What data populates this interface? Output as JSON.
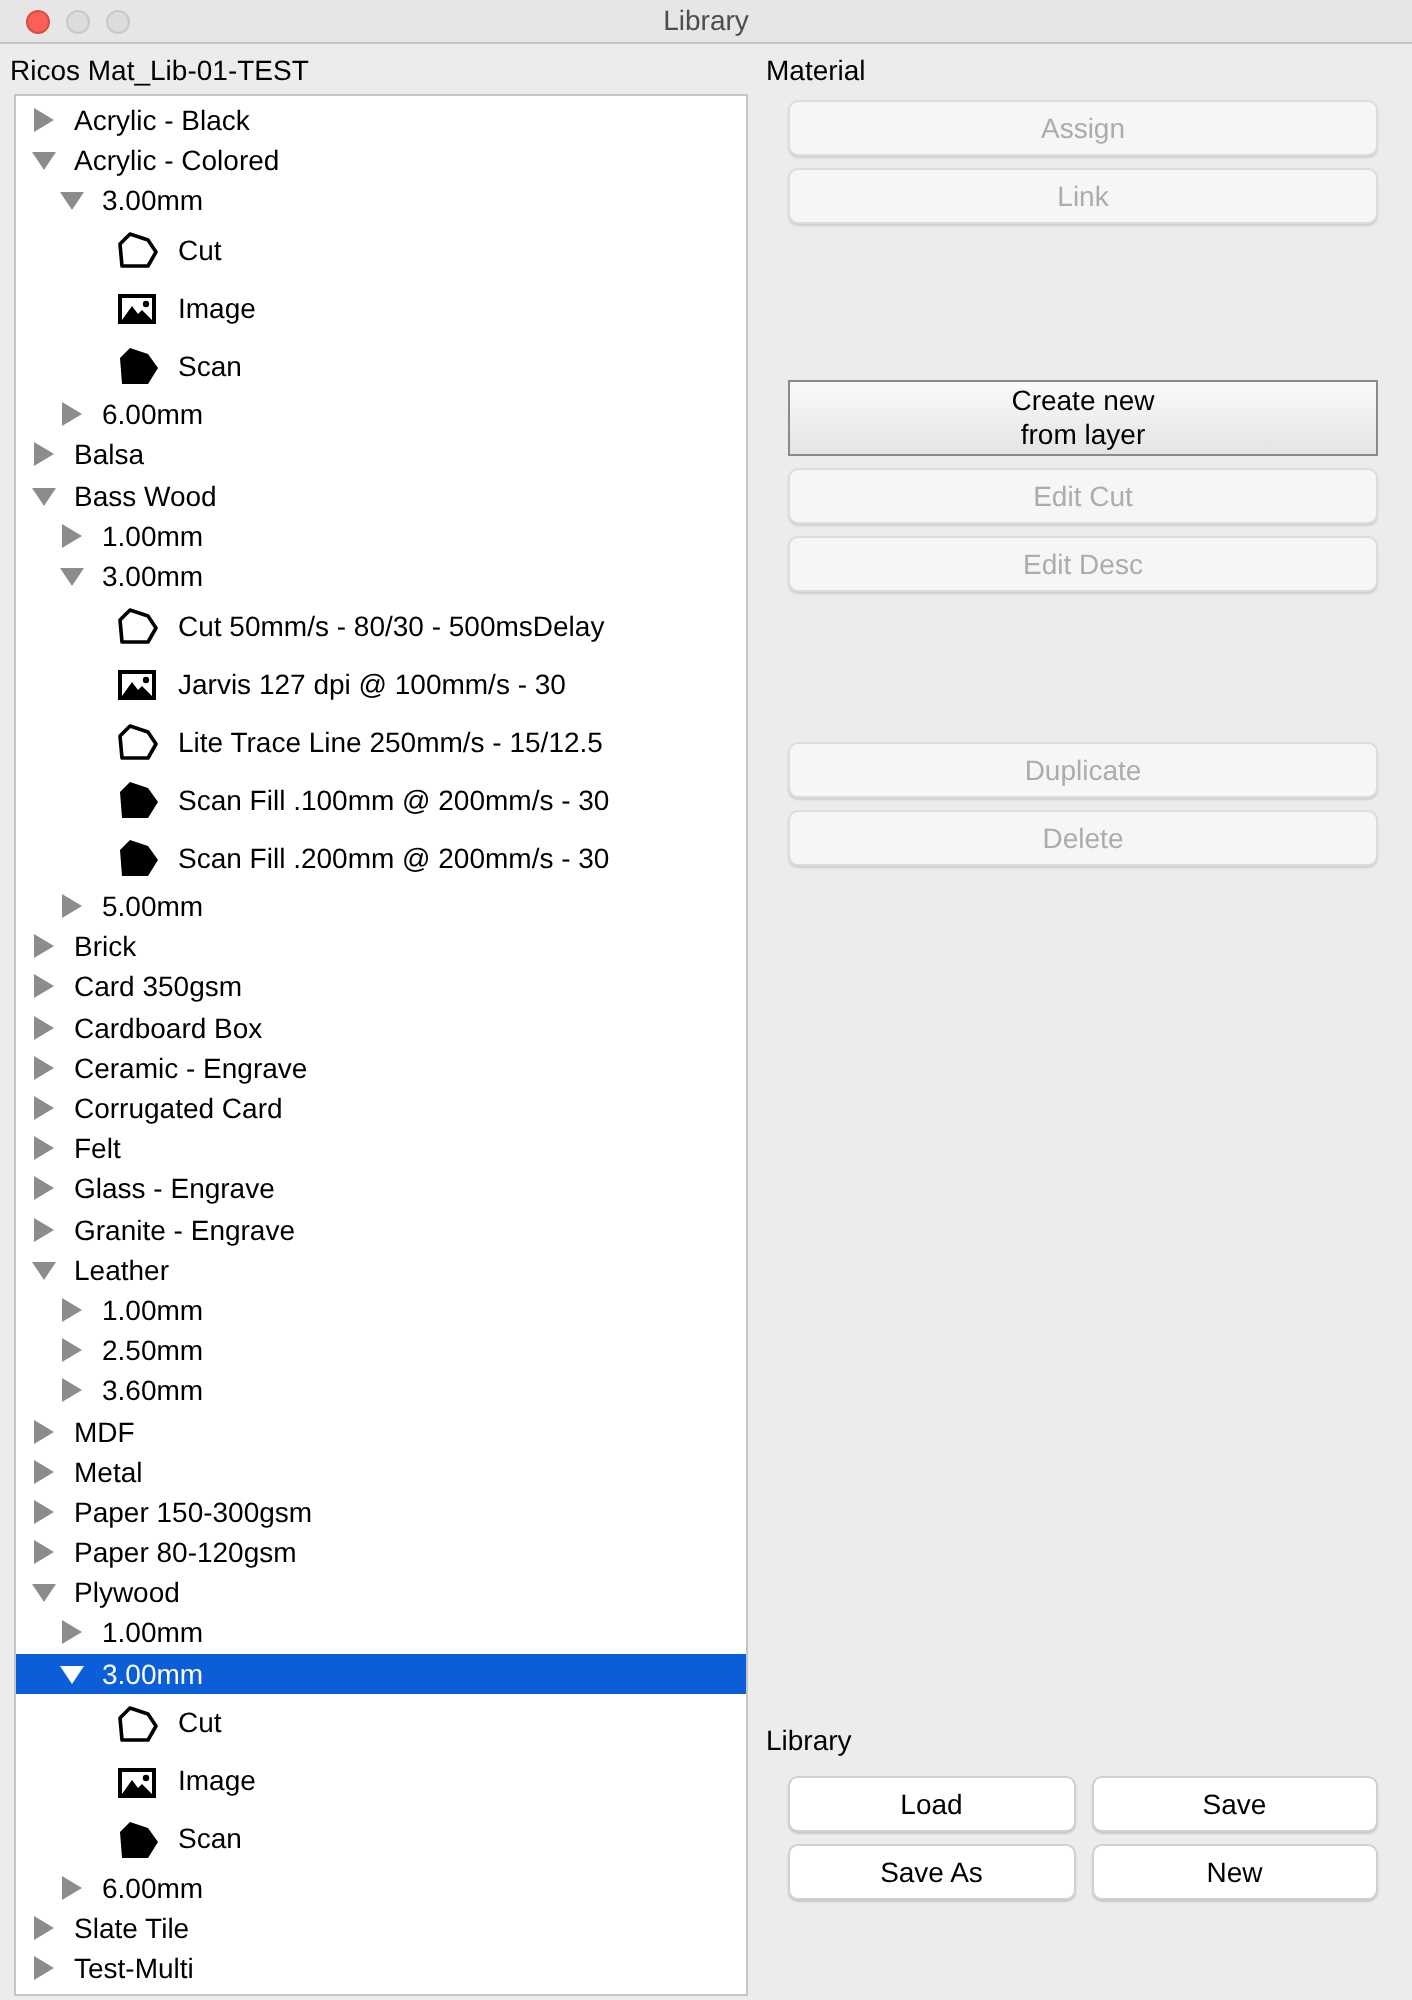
{
  "window": {
    "title": "Library"
  },
  "tree_title": "Ricos Mat_Lib-01-TEST",
  "tree": [
    {
      "kind": "folder",
      "label": "Acrylic - Black",
      "expanded": false,
      "selected": false
    },
    {
      "kind": "folder",
      "label": "Acrylic - Colored",
      "expanded": true,
      "selected": false,
      "children": [
        {
          "kind": "folder",
          "label": "3.00mm",
          "expanded": true,
          "selected": false,
          "children": [
            {
              "kind": "cut",
              "label": "Cut",
              "selected": false
            },
            {
              "kind": "image",
              "label": "Image",
              "selected": false
            },
            {
              "kind": "scan",
              "label": "Scan",
              "selected": false
            }
          ]
        },
        {
          "kind": "folder",
          "label": "6.00mm",
          "expanded": false,
          "selected": false
        }
      ]
    },
    {
      "kind": "folder",
      "label": "Balsa",
      "expanded": false,
      "selected": false
    },
    {
      "kind": "folder",
      "label": "Bass Wood",
      "expanded": true,
      "selected": false,
      "children": [
        {
          "kind": "folder",
          "label": "1.00mm",
          "expanded": false,
          "selected": false
        },
        {
          "kind": "folder",
          "label": "3.00mm",
          "expanded": true,
          "selected": false,
          "children": [
            {
              "kind": "cut",
              "label": "Cut 50mm/s - 80/30 - 500msDelay",
              "selected": false
            },
            {
              "kind": "image",
              "label": "Jarvis 127 dpi @ 100mm/s - 30",
              "selected": false
            },
            {
              "kind": "cut",
              "label": "Lite Trace Line 250mm/s - 15/12.5",
              "selected": false
            },
            {
              "kind": "scan",
              "label": "Scan Fill .100mm @ 200mm/s - 30",
              "selected": false
            },
            {
              "kind": "scan",
              "label": "Scan Fill .200mm @ 200mm/s - 30",
              "selected": false
            }
          ]
        },
        {
          "kind": "folder",
          "label": "5.00mm",
          "expanded": false,
          "selected": false
        }
      ]
    },
    {
      "kind": "folder",
      "label": "Brick",
      "expanded": false,
      "selected": false
    },
    {
      "kind": "folder",
      "label": "Card 350gsm",
      "expanded": false,
      "selected": false
    },
    {
      "kind": "folder",
      "label": "Cardboard Box",
      "expanded": false,
      "selected": false
    },
    {
      "kind": "folder",
      "label": "Ceramic - Engrave",
      "expanded": false,
      "selected": false
    },
    {
      "kind": "folder",
      "label": "Corrugated Card",
      "expanded": false,
      "selected": false
    },
    {
      "kind": "folder",
      "label": "Felt",
      "expanded": false,
      "selected": false
    },
    {
      "kind": "folder",
      "label": "Glass - Engrave",
      "expanded": false,
      "selected": false
    },
    {
      "kind": "folder",
      "label": "Granite - Engrave",
      "expanded": false,
      "selected": false
    },
    {
      "kind": "folder",
      "label": "Leather",
      "expanded": true,
      "selected": false,
      "children": [
        {
          "kind": "folder",
          "label": "1.00mm",
          "expanded": false,
          "selected": false
        },
        {
          "kind": "folder",
          "label": "2.50mm",
          "expanded": false,
          "selected": false
        },
        {
          "kind": "folder",
          "label": "3.60mm",
          "expanded": false,
          "selected": false
        }
      ]
    },
    {
      "kind": "folder",
      "label": "MDF",
      "expanded": false,
      "selected": false
    },
    {
      "kind": "folder",
      "label": "Metal",
      "expanded": false,
      "selected": false
    },
    {
      "kind": "folder",
      "label": "Paper 150-300gsm",
      "expanded": false,
      "selected": false
    },
    {
      "kind": "folder",
      "label": "Paper 80-120gsm",
      "expanded": false,
      "selected": false
    },
    {
      "kind": "folder",
      "label": "Plywood",
      "expanded": true,
      "selected": false,
      "children": [
        {
          "kind": "folder",
          "label": "1.00mm",
          "expanded": false,
          "selected": false
        },
        {
          "kind": "folder",
          "label": "3.00mm",
          "expanded": true,
          "selected": true,
          "children": [
            {
              "kind": "cut",
              "label": "Cut",
              "selected": false
            },
            {
              "kind": "image",
              "label": "Image",
              "selected": false
            },
            {
              "kind": "scan",
              "label": "Scan",
              "selected": false
            }
          ]
        },
        {
          "kind": "folder",
          "label": "6.00mm",
          "expanded": false,
          "selected": false
        }
      ]
    },
    {
      "kind": "folder",
      "label": "Slate Tile",
      "expanded": false,
      "selected": false
    },
    {
      "kind": "folder",
      "label": "Test-Multi",
      "expanded": false,
      "selected": false
    }
  ],
  "material": {
    "title": "Material",
    "button_groups": [
      [
        {
          "label": "Assign",
          "disabled": true,
          "emphasized": false
        },
        {
          "label": "Link",
          "disabled": true,
          "emphasized": false
        }
      ],
      [
        {
          "label": "Create new\nfrom layer",
          "disabled": false,
          "emphasized": true
        },
        {
          "label": "Edit Cut",
          "disabled": true,
          "emphasized": false
        },
        {
          "label": "Edit Desc",
          "disabled": true,
          "emphasized": false
        }
      ],
      [
        {
          "label": "Duplicate",
          "disabled": true,
          "emphasized": false
        },
        {
          "label": "Delete",
          "disabled": true,
          "emphasized": false
        }
      ]
    ]
  },
  "library": {
    "title": "Library",
    "buttons": [
      {
        "label": "Load",
        "disabled": false
      },
      {
        "label": "Save",
        "disabled": false
      },
      {
        "label": "Save As",
        "disabled": false
      },
      {
        "label": "New",
        "disabled": false
      }
    ]
  }
}
